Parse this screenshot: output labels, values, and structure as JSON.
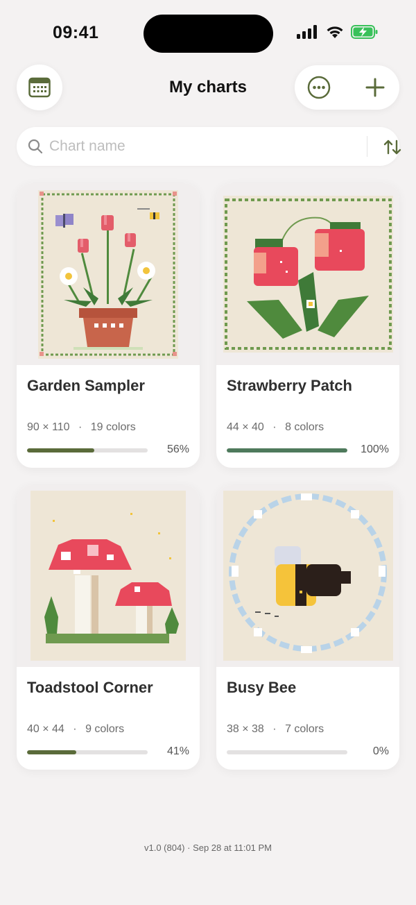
{
  "status_bar": {
    "time": "09:41"
  },
  "header": {
    "title": "My charts"
  },
  "search": {
    "placeholder": "Chart name",
    "value": ""
  },
  "charts": [
    {
      "name": "Garden Sampler",
      "size": "90 × 110",
      "colors": "19 colors",
      "progress_label": "56%",
      "progress": 0.56,
      "bar_color": "#5a6b3a"
    },
    {
      "name": "Strawberry Patch",
      "size": "44 × 40",
      "colors": "8 colors",
      "progress_label": "100%",
      "progress": 1.0,
      "bar_color": "#4e7a5c"
    },
    {
      "name": "Toadstool Corner",
      "size": "40 × 44",
      "colors": "9 colors",
      "progress_label": "41%",
      "progress": 0.41,
      "bar_color": "#5a6b3a"
    },
    {
      "name": "Busy Bee",
      "size": "38 × 38",
      "colors": "7 colors",
      "progress_label": "0%",
      "progress": 0.0,
      "bar_color": "#5a6b3a"
    }
  ],
  "meta_separator": "·",
  "footer": {
    "version": "v1.0 (804) · Sep 28 at 11:01 PM"
  },
  "colors": {
    "accent": "#556b2f",
    "background": "#f4f2f2"
  }
}
